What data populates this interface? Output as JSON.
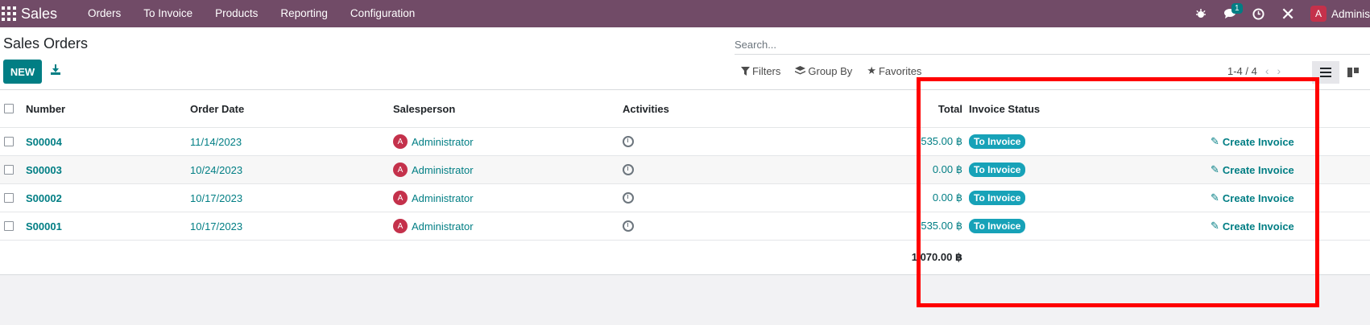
{
  "navbar": {
    "brand": "Sales",
    "menu": [
      "Orders",
      "To Invoice",
      "Products",
      "Reporting",
      "Configuration"
    ],
    "message_count": "1",
    "user_initial": "A",
    "user_name": "Adminis"
  },
  "control": {
    "page_title": "Sales Orders",
    "new_label": "NEW",
    "search_placeholder": "Search...",
    "filters_label": "Filters",
    "groupby_label": "Group By",
    "favorites_label": "Favorites",
    "pager": "1-4 / 4"
  },
  "table": {
    "headers": {
      "number": "Number",
      "order_date": "Order Date",
      "salesperson": "Salesperson",
      "activities": "Activities",
      "total": "Total",
      "invoice_status": "Invoice Status"
    },
    "rows": [
      {
        "number": "S00004",
        "date": "11/14/2023",
        "initial": "A",
        "salesperson": "Administrator",
        "total": "535.00 ฿",
        "status": "To Invoice",
        "action": "Create Invoice"
      },
      {
        "number": "S00003",
        "date": "10/24/2023",
        "initial": "A",
        "salesperson": "Administrator",
        "total": "0.00 ฿",
        "status": "To Invoice",
        "action": "Create Invoice"
      },
      {
        "number": "S00002",
        "date": "10/17/2023",
        "initial": "A",
        "salesperson": "Administrator",
        "total": "0.00 ฿",
        "status": "To Invoice",
        "action": "Create Invoice"
      },
      {
        "number": "S00001",
        "date": "10/17/2023",
        "initial": "A",
        "salesperson": "Administrator",
        "total": "535.00 ฿",
        "status": "To Invoice",
        "action": "Create Invoice"
      }
    ],
    "grand_total": "1,070.00 ฿"
  },
  "colors": {
    "navbar": "#714b67",
    "primary": "#017e84",
    "tag": "#17a2b8",
    "highlight": "#ff0000"
  }
}
